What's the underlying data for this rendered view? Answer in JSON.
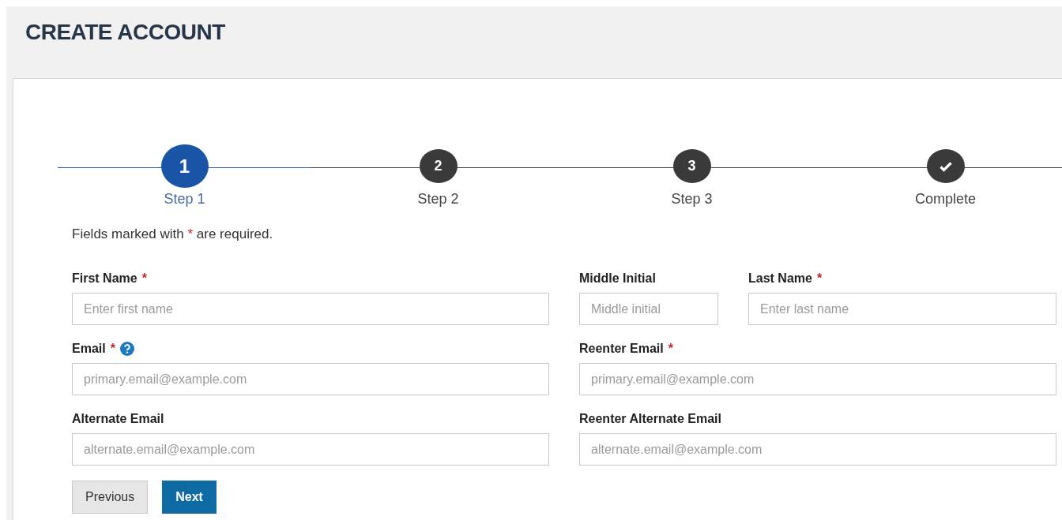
{
  "title": "CREATE ACCOUNT",
  "steps": [
    {
      "kind": "number",
      "label": "Step 1",
      "number": "1",
      "selected": true
    },
    {
      "kind": "number",
      "label": "Step 2",
      "number": "2",
      "selected": false
    },
    {
      "kind": "number",
      "label": "Step 3",
      "number": "3",
      "selected": false
    },
    {
      "kind": "check",
      "label": "Complete",
      "selected": false
    }
  ],
  "required_note": {
    "before": "Fields marked with",
    "mark": "*",
    "after": "are required."
  },
  "rows": [
    {
      "fields": [
        {
          "label": "First Name",
          "required": true,
          "help": false,
          "placeholder": "Enter first name"
        },
        {
          "label": "Middle Initial",
          "required": false,
          "help": false,
          "placeholder": "Middle initial"
        },
        {
          "label": "Last Name",
          "required": true,
          "help": false,
          "placeholder": "Enter last name"
        }
      ]
    },
    {
      "fields": [
        {
          "label": "Email",
          "required": true,
          "help": true,
          "placeholder": "primary.email@example.com"
        },
        {
          "label": "Reenter Email",
          "required": true,
          "help": false,
          "placeholder": "primary.email@example.com"
        }
      ]
    },
    {
      "fields": [
        {
          "label": "Alternate Email",
          "required": false,
          "help": false,
          "placeholder": "alternate.email@example.com"
        },
        {
          "label": "Reenter Alternate Email",
          "required": false,
          "help": false,
          "placeholder": "alternate.email@example.com"
        }
      ]
    }
  ],
  "buttons": [
    {
      "kind": "secondary",
      "label": "Previous"
    },
    {
      "kind": "primary",
      "label": "Next"
    }
  ]
}
